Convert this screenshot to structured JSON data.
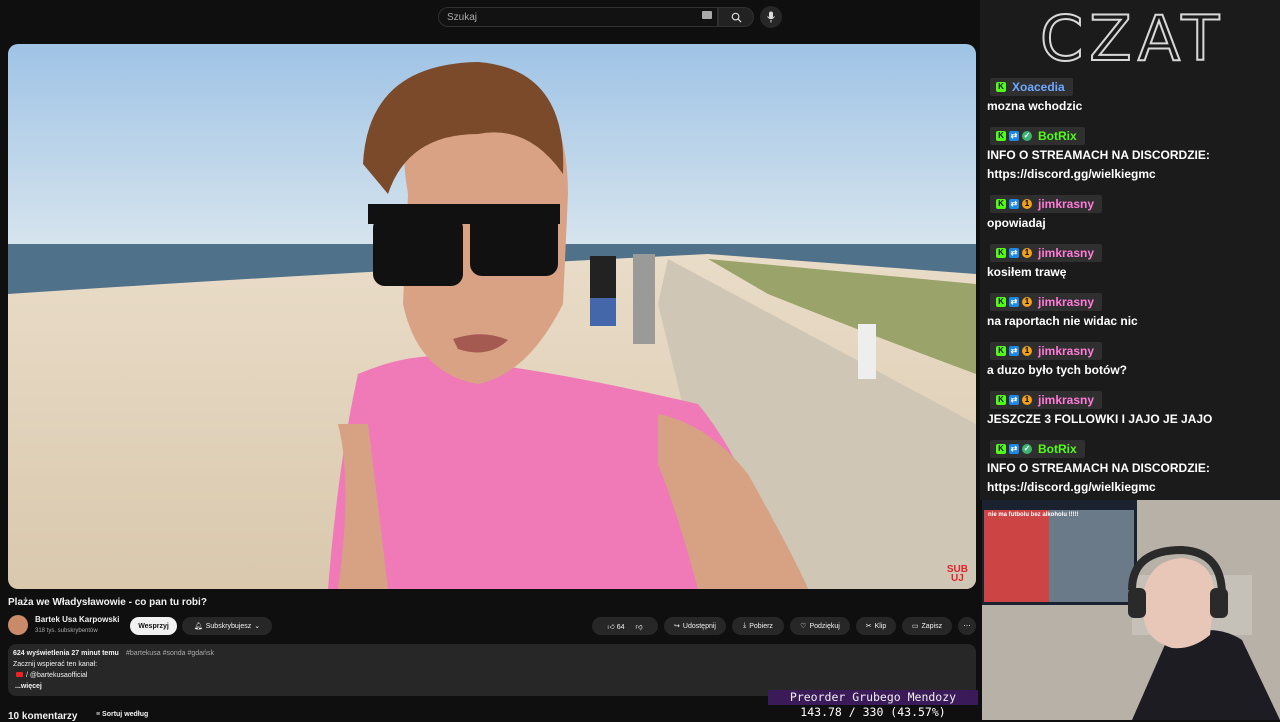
{
  "search": {
    "placeholder": "Szukaj"
  },
  "video": {
    "title": "Plaża we Władysławowie - co pan tu robi?",
    "watermark_line1": "SUB",
    "watermark_line2": "UJ"
  },
  "channel": {
    "name": "Bartek Usa Karpowski",
    "subscribers": "318 tys. subskrybentów"
  },
  "buttons": {
    "support": "Wesprzyj",
    "subscribed": "Subskrybujesz",
    "likes": "64",
    "share": "Udostępnij",
    "download": "Pobierz",
    "thanks": "Podziękuj",
    "clip": "Klip",
    "save": "Zapisz"
  },
  "description": {
    "stats": "624 wyświetlenia  27 minut temu",
    "tags": "#bartekusa #sonda #gdańsk",
    "line2": "Zacznij wspierać ten kanał:",
    "line3": "/ @bartekusaofficial",
    "more": "...więcej"
  },
  "comments": {
    "count": "10 komentarzy",
    "sort": "Sortuj według"
  },
  "chat": {
    "title": "CZAT",
    "messages": [
      {
        "user": "Xoacedia",
        "color": "#6fa8ff",
        "text": "mozna wchodzic",
        "badges": [
          "k"
        ]
      },
      {
        "user": "BotRix",
        "color": "#53fc18",
        "text": "INFO O STREAMACH NA DISCORDZIE: https://discord.gg/wielkiegmc",
        "badges": [
          "k",
          "s",
          "v"
        ]
      },
      {
        "user": "jimkrasny",
        "color": "#ff7ad9",
        "text": "opowiadaj",
        "badges": [
          "k",
          "s",
          "o"
        ]
      },
      {
        "user": "jimkrasny",
        "color": "#ff7ad9",
        "text": "kosiłem trawę",
        "badges": [
          "k",
          "s",
          "o"
        ]
      },
      {
        "user": "jimkrasny",
        "color": "#ff7ad9",
        "text": "na raportach nie widac nic",
        "badges": [
          "k",
          "s",
          "o"
        ]
      },
      {
        "user": "jimkrasny",
        "color": "#ff7ad9",
        "text": "a duzo było tych botów?",
        "badges": [
          "k",
          "s",
          "o"
        ]
      },
      {
        "user": "jimkrasny",
        "color": "#ff7ad9",
        "text": "JESZCZE 3 FOLLOWKI I JAJO JE JAJO",
        "badges": [
          "k",
          "s",
          "o"
        ]
      },
      {
        "user": "BotRix",
        "color": "#53fc18",
        "text": "INFO O STREAMACH NA DISCORDZIE: https://discord.gg/wielkiegmc",
        "badges": [
          "k",
          "s",
          "v"
        ]
      }
    ]
  },
  "webcam_banner": "nie ma futbolu bez alkoholu !!!!!",
  "overlay": {
    "line1": "Preorder Grubego Mendozy",
    "line2": "143.78 / 330 (43.57%)"
  }
}
